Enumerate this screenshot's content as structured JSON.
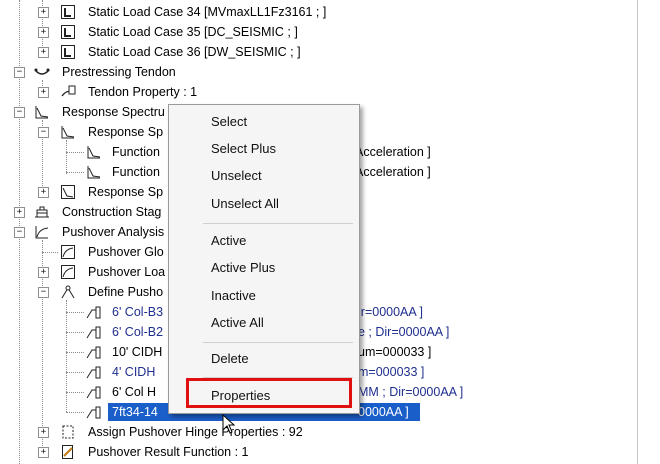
{
  "tree": {
    "rows": [
      {
        "label": "Static Load Case 34 [MVmaxLL1Fz3161 ; ]"
      },
      {
        "label": "Static Load Case 35 [DC_SEISMIC ; ]"
      },
      {
        "label": "Static Load Case 36 [DW_SEISMIC ; ]"
      },
      {
        "label": "Prestressing Tendon"
      },
      {
        "label": "Tendon Property : 1"
      },
      {
        "label": "Response Spectru"
      },
      {
        "label": "Response Sp"
      },
      {
        "label": "Function",
        "suffix": "Acceleration ]"
      },
      {
        "label": "Function",
        "suffix": "Acceleration ]"
      },
      {
        "label": "Response Sp"
      },
      {
        "label": "Construction Stag"
      },
      {
        "label": "Pushover Analysis"
      },
      {
        "label": "Pushover Glo"
      },
      {
        "label": "Pushover Loa"
      },
      {
        "label": "Define Pusho"
      },
      {
        "label": "6' Col-B3",
        "suffix": "ir=0000AA ]"
      },
      {
        "label": "6' Col-B2",
        "suffix": "e ; Dir=0000AA ]"
      },
      {
        "label": "10' CIDH",
        "suffix": "um=000033 ]"
      },
      {
        "label": "4' CIDH",
        "suffix": "m=000033 ]"
      },
      {
        "label": "6' Col H",
        "suffix": "MM ; Dir=0000AA ]"
      },
      {
        "label": "7ft34-14",
        "suffix": "0000AA ]"
      },
      {
        "label": "Assign Pushover Hinge Properties : 92"
      },
      {
        "label": "Pushover Result Function : 1"
      }
    ]
  },
  "context_menu": {
    "items": [
      "Select",
      "Select Plus",
      "Unselect",
      "Unselect All",
      "Active",
      "Active Plus",
      "Inactive",
      "Active All",
      "Delete",
      "Properties"
    ]
  },
  "colors": {
    "highlight": "#1a5ec9",
    "callout": "#e01010",
    "hinge_text": "#1f2f8f"
  }
}
